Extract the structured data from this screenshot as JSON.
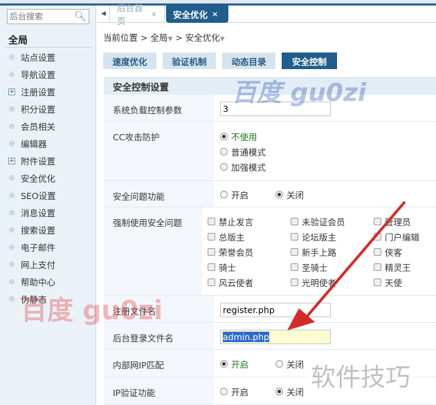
{
  "sidebar": {
    "search_placeholder": "后台搜索",
    "title": "全局",
    "items": [
      {
        "label": "站点设置",
        "type": "bullet"
      },
      {
        "label": "导航设置",
        "type": "bullet"
      },
      {
        "label": "注册设置",
        "type": "plus"
      },
      {
        "label": "积分设置",
        "type": "bullet"
      },
      {
        "label": "会员相关",
        "type": "bullet"
      },
      {
        "label": "编辑器",
        "type": "bullet"
      },
      {
        "label": "附件设置",
        "type": "plus"
      },
      {
        "label": "安全优化",
        "type": "bullet"
      },
      {
        "label": "SEO设置",
        "type": "bullet"
      },
      {
        "label": "消息设置",
        "type": "bullet"
      },
      {
        "label": "搜索设置",
        "type": "bullet"
      },
      {
        "label": "电子邮件",
        "type": "bullet"
      },
      {
        "label": "网上支付",
        "type": "bullet"
      },
      {
        "label": "帮助中心",
        "type": "bullet"
      },
      {
        "label": "伪静态",
        "type": "bullet"
      }
    ]
  },
  "tabs": {
    "home": "后台首页",
    "active": "安全优化",
    "close": "×"
  },
  "breadcrumb": {
    "prefix": "当前位置 > ",
    "global": "全局",
    "sep": " > ",
    "current": "安全优化"
  },
  "subtabs": [
    "速度优化",
    "验证机制",
    "动态目录",
    "安全控制"
  ],
  "form": {
    "title": "安全控制设置",
    "load_label": "系统负载控制参数",
    "load_value": "3",
    "cc_label": "CC攻击防护",
    "cc_options": [
      "不使用",
      "普通模式",
      "加强模式"
    ],
    "sq_label": "安全问题功能",
    "on": "开启",
    "off": "关闭",
    "force_label": "强制使用安全问题",
    "groups": [
      "禁止发言",
      "未验证会员",
      "管理员",
      "总版主",
      "论坛版主",
      "门户编辑",
      "荣誉会员",
      "新手上路",
      "侠客",
      "骑士",
      "圣骑士",
      "精灵王",
      "风云使者",
      "光明使者",
      "天使"
    ],
    "reg_label": "注册文件名",
    "reg_value": "register.php",
    "admin_label": "后台登录文件名",
    "admin_value": "admin.php",
    "lan_label": "内部网IP匹配",
    "ipv_label": "IP验证功能"
  },
  "watermarks": {
    "top": "百度 gu0zi",
    "left": "百度 gu0zi",
    "bottom": "软件技巧"
  },
  "colors": {
    "accent": "#1f5d8c",
    "arrow": "#d42a2a"
  }
}
